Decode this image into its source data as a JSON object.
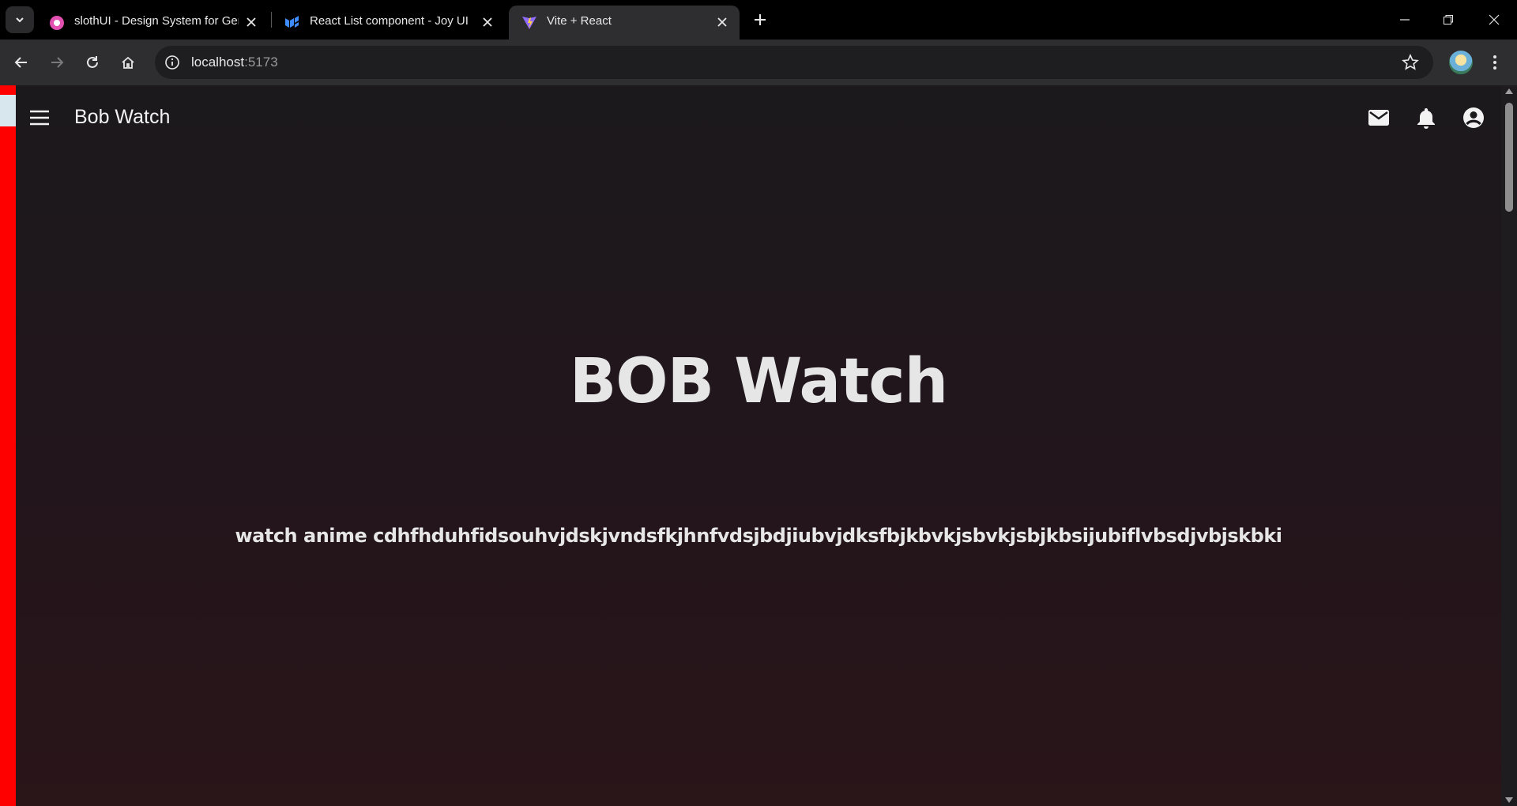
{
  "browser": {
    "tabs": [
      {
        "title": "slothUI - Design System for Ger",
        "favicon": "slothui-icon",
        "active": false
      },
      {
        "title": "React List component - Joy UI",
        "favicon": "mui-icon",
        "active": false
      },
      {
        "title": "Vite + React",
        "favicon": "vite-icon",
        "active": true
      }
    ],
    "address": {
      "host": "localhost",
      "port": ":5173"
    }
  },
  "app": {
    "title": "Bob Watch",
    "hero_heading": "BOB Watch",
    "subtitle": "watch anime cdhfhduhfidsouhvjdskjvndsfkjhnfvdsjbdjiubvjdksfbjkbvkjsbvkjsbjkbsijubiflvbsdjvbjskbki",
    "icons": [
      "menu-icon",
      "mail-icon",
      "bell-icon",
      "account-circle-icon"
    ]
  },
  "colors": {
    "sidebar_accent": "#ff0000",
    "page_bg_top": "#1b191c",
    "page_bg_bottom": "#2a1519",
    "text": "#e6e6e6"
  }
}
